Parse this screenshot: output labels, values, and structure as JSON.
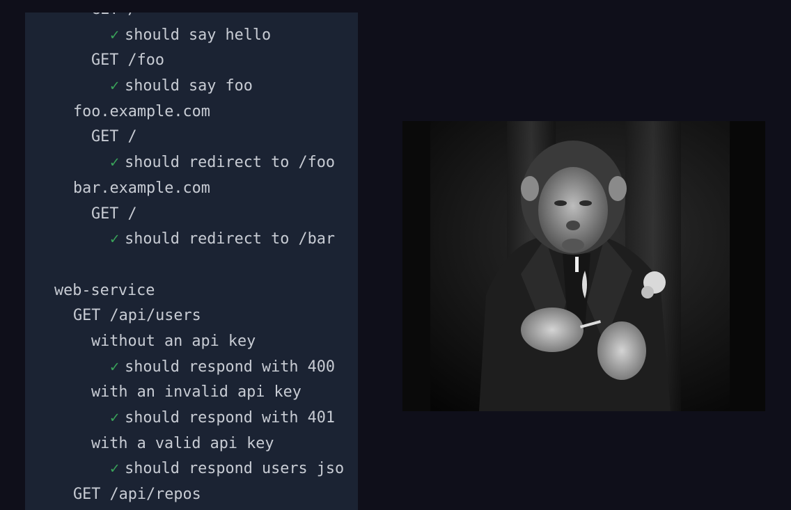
{
  "terminal": {
    "lines": [
      {
        "indent": 4,
        "check": false,
        "text": "GET /"
      },
      {
        "indent": 5,
        "check": true,
        "text": "should say hello"
      },
      {
        "indent": 4,
        "check": false,
        "text": "GET /foo"
      },
      {
        "indent": 5,
        "check": true,
        "text": "should say foo"
      },
      {
        "indent": 3,
        "check": false,
        "text": "foo.example.com"
      },
      {
        "indent": 4,
        "check": false,
        "text": "GET /"
      },
      {
        "indent": 5,
        "check": true,
        "text": "should redirect to /foo"
      },
      {
        "indent": 3,
        "check": false,
        "text": "bar.example.com"
      },
      {
        "indent": 4,
        "check": false,
        "text": "GET /"
      },
      {
        "indent": 5,
        "check": true,
        "text": "should redirect to /bar"
      },
      {
        "indent": 0,
        "check": false,
        "text": ""
      },
      {
        "indent": 2,
        "check": false,
        "text": "web-service"
      },
      {
        "indent": 3,
        "check": false,
        "text": "GET /api/users"
      },
      {
        "indent": 4,
        "check": false,
        "text": "without an api key"
      },
      {
        "indent": 5,
        "check": true,
        "text": "should respond with 400"
      },
      {
        "indent": 4,
        "check": false,
        "text": "with an invalid api key"
      },
      {
        "indent": 5,
        "check": true,
        "text": "should respond with 401"
      },
      {
        "indent": 4,
        "check": false,
        "text": "with a valid api key"
      },
      {
        "indent": 5,
        "check": true,
        "text": "should respond users jso"
      },
      {
        "indent": 3,
        "check": false,
        "text": "GET /api/repos"
      }
    ],
    "check_symbol": "✓"
  },
  "photo": {
    "description_icon": "chimpanzee-photo"
  },
  "colors": {
    "background": "#0f0f1a",
    "terminal_bg": "#1b2333",
    "text": "#c8ccd4",
    "check": "#3aa45a"
  }
}
